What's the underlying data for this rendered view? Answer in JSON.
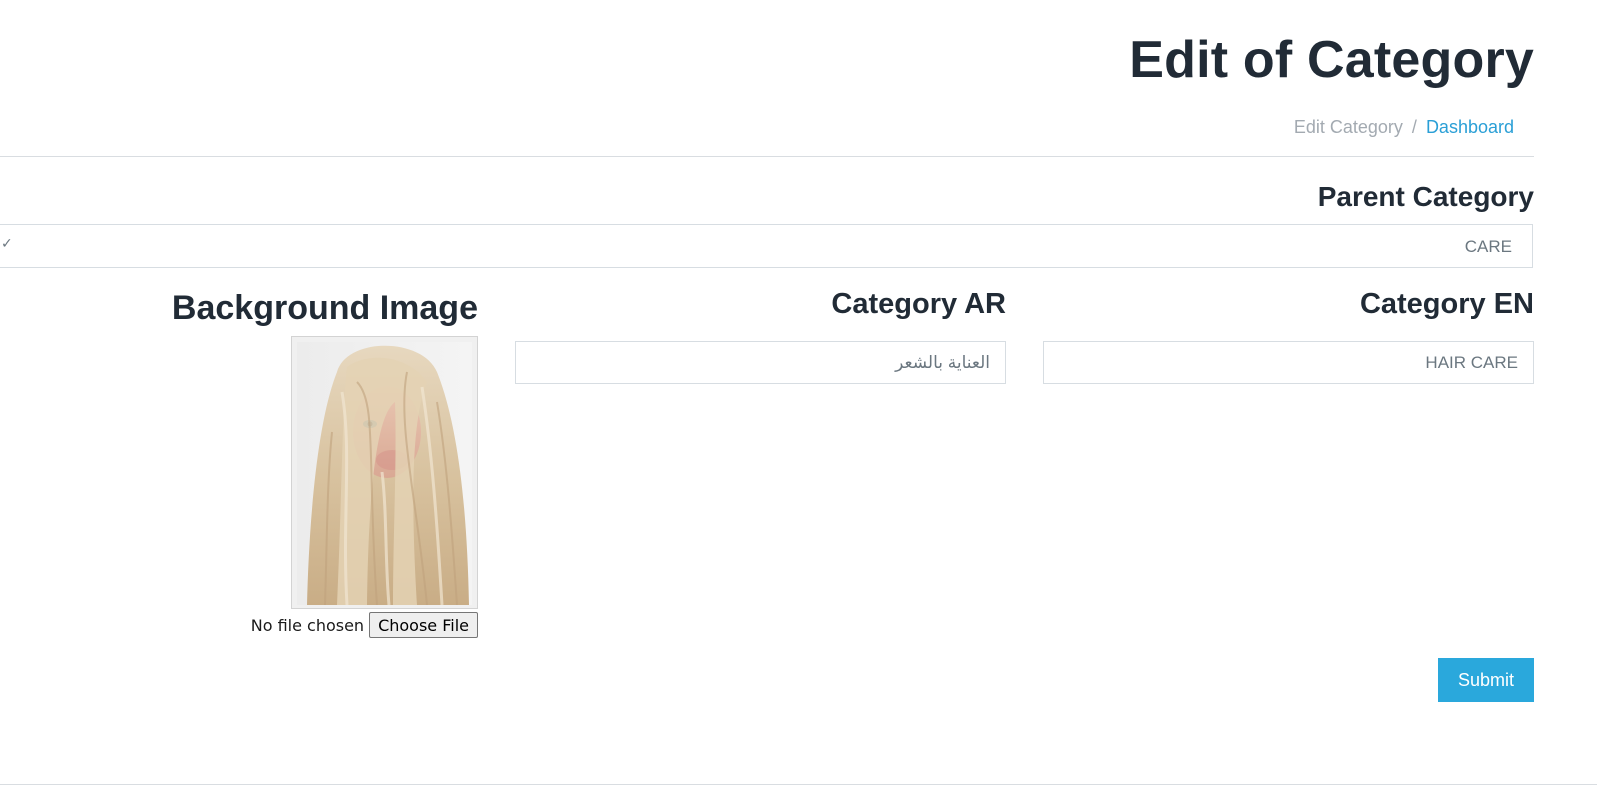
{
  "header": {
    "title": "Edit of Category",
    "breadcrumb": {
      "current": "Edit Category",
      "separator": "/",
      "link": "Dashboard"
    }
  },
  "form": {
    "parent_category": {
      "label": "Parent Category",
      "selected": "CARE"
    },
    "category_en": {
      "label": "Category EN",
      "value": "HAIR CARE"
    },
    "category_ar": {
      "label": "Category AR",
      "value": "العناية بالشعر"
    },
    "background_image": {
      "label": "Background Image",
      "file_status": "No file chosen",
      "choose_button": "Choose File"
    },
    "submit_label": "Submit"
  },
  "colors": {
    "accent": "#2aa8dc",
    "link": "#2a9fd6",
    "text": "#212b36",
    "muted": "#a3aab1"
  }
}
